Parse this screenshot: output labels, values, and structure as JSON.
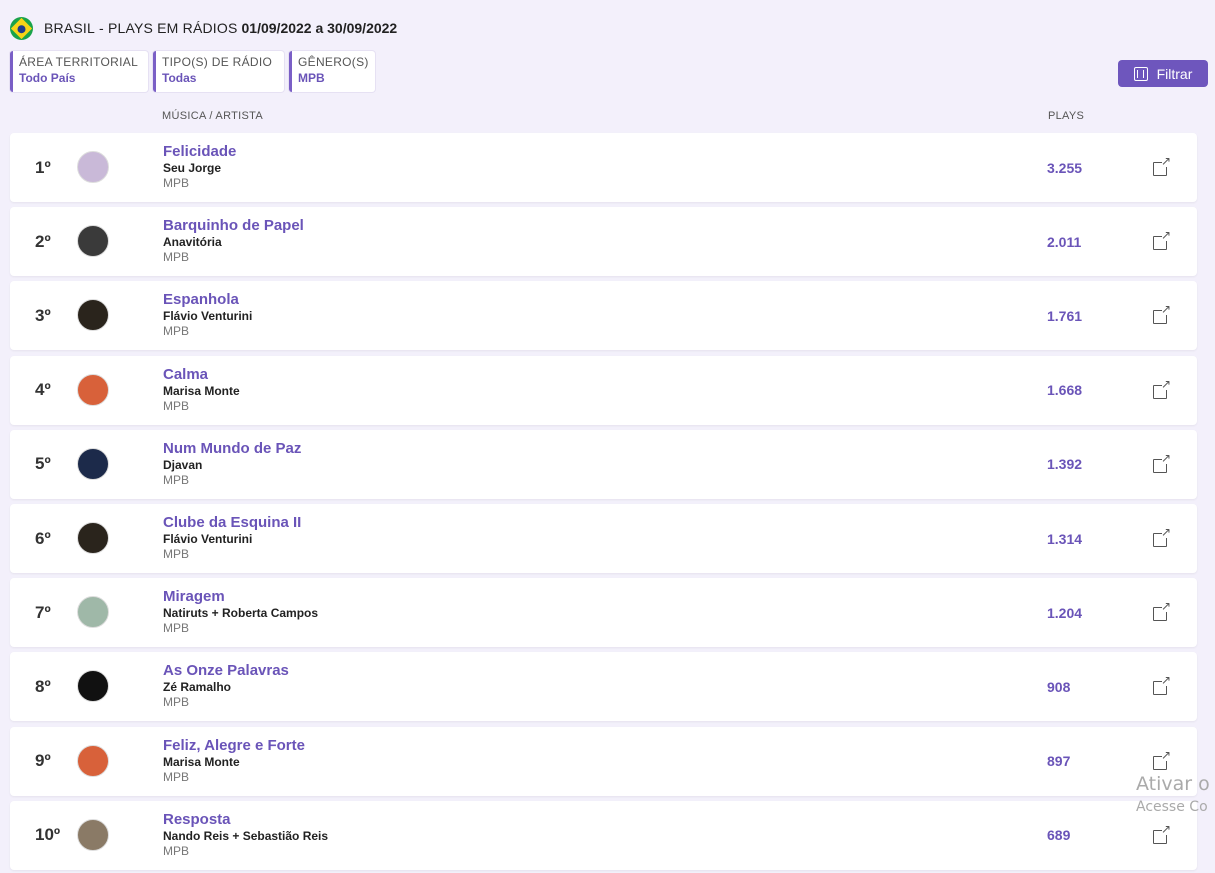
{
  "header": {
    "country": "BRASIL",
    "title": "- PLAYS EM RÁDIOS",
    "dates": "01/09/2022 a 30/09/2022"
  },
  "filters": [
    {
      "label": "ÁREA TERRITORIAL",
      "value": "Todo País"
    },
    {
      "label": "TIPO(S) DE RÁDIO",
      "value": "Todas"
    },
    {
      "label": "GÊNERO(S)",
      "value": "MPB"
    }
  ],
  "filter_button": "Filtrar",
  "columns": {
    "music": "MÚSICA / ARTISTA",
    "plays": "PLAYS"
  },
  "rows": [
    {
      "rank": "1º",
      "song": "Felicidade",
      "artist": "Seu Jorge",
      "genre": "MPB",
      "plays": "3.255",
      "avatar_color": "#c9b9d8"
    },
    {
      "rank": "2º",
      "song": "Barquinho de Papel",
      "artist": "Anavitória",
      "genre": "MPB",
      "plays": "2.011",
      "avatar_color": "#3a3a3a"
    },
    {
      "rank": "3º",
      "song": "Espanhola",
      "artist": "Flávio Venturini",
      "genre": "MPB",
      "plays": "1.761",
      "avatar_color": "#2a241c"
    },
    {
      "rank": "4º",
      "song": "Calma",
      "artist": "Marisa Monte",
      "genre": "MPB",
      "plays": "1.668",
      "avatar_color": "#d8613a"
    },
    {
      "rank": "5º",
      "song": "Num Mundo de Paz",
      "artist": "Djavan",
      "genre": "MPB",
      "plays": "1.392",
      "avatar_color": "#1c2a4a"
    },
    {
      "rank": "6º",
      "song": "Clube da Esquina II",
      "artist": "Flávio Venturini",
      "genre": "MPB",
      "plays": "1.314",
      "avatar_color": "#2a241c"
    },
    {
      "rank": "7º",
      "song": "Miragem",
      "artist": "Natiruts + Roberta Campos",
      "genre": "MPB",
      "plays": "1.204",
      "avatar_color": "#9fb8a8"
    },
    {
      "rank": "8º",
      "song": "As Onze Palavras",
      "artist": "Zé Ramalho",
      "genre": "MPB",
      "plays": "908",
      "avatar_color": "#111111"
    },
    {
      "rank": "9º",
      "song": "Feliz, Alegre e Forte",
      "artist": "Marisa Monte",
      "genre": "MPB",
      "plays": "897",
      "avatar_color": "#d8613a"
    },
    {
      "rank": "10º",
      "song": "Resposta",
      "artist": "Nando Reis + Sebastião Reis",
      "genre": "MPB",
      "plays": "689",
      "avatar_color": "#8a7a66"
    }
  ],
  "watermark": {
    "line1": "Ativar o",
    "line2": "Acesse Co"
  }
}
